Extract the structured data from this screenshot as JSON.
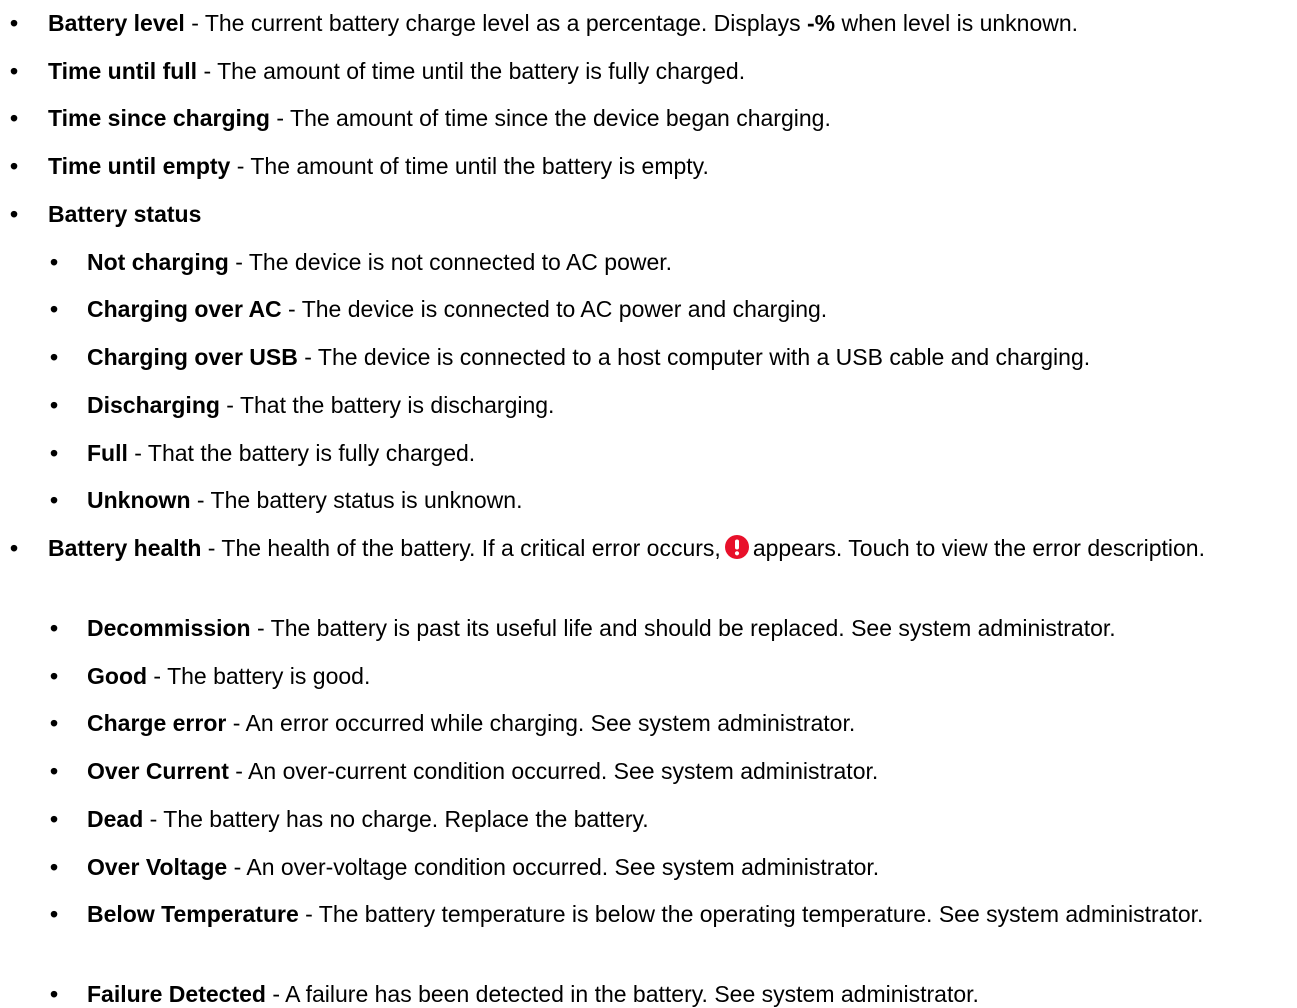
{
  "items": [
    {
      "term": "Battery level",
      "sep": " - ",
      "desc_a": "The current battery charge level as a percentage. Displays ",
      "desc_strong": "-%",
      "desc_b": " when level is unknown."
    },
    {
      "term": "Time until full",
      "sep": " - ",
      "desc": "The amount of time until the battery is fully charged."
    },
    {
      "term": "Time since charging",
      "sep": " - ",
      "desc": "The amount of time since the device began charging."
    },
    {
      "term": "Time until empty",
      "sep": " - ",
      "desc": "The amount of time until the battery is empty."
    },
    {
      "term": "Battery status"
    },
    {
      "term": "Not charging",
      "sep": " - ",
      "desc": "The device is not connected to AC power."
    },
    {
      "term": "Charging over AC",
      "sep": " - ",
      "desc": "The device is connected to AC power and charging."
    },
    {
      "term": "Charging over USB",
      "sep": " - ",
      "desc": "The device is connected to a host computer with a USB cable and charging."
    },
    {
      "term": "Discharging",
      "sep": " - ",
      "desc": "That the battery is discharging."
    },
    {
      "term": "Full",
      "sep": " - ",
      "desc": "That the battery is fully charged."
    },
    {
      "term": "Unknown",
      "sep": " - ",
      "desc": "The battery status is unknown."
    },
    {
      "term": "Battery health",
      "sep": " - ",
      "desc_a": "The health of the battery. If a critical error occurs,",
      "desc_b": "appears. Touch to view the error description.",
      "icon": "critical-error-icon",
      "icon_color": "#e8102a"
    },
    {
      "term": "Decommission",
      "sep": " - ",
      "desc": "The battery is past its useful life and should be replaced. See system administrator."
    },
    {
      "term": "Good",
      "sep": " - ",
      "desc": "The battery is good."
    },
    {
      "term": "Charge error",
      "sep": " - ",
      "desc": "An error occurred while charging. See system administrator."
    },
    {
      "term": "Over Current",
      "sep": " - ",
      "desc": "An over-current condition occurred. See system administrator."
    },
    {
      "term": "Dead",
      "sep": " - ",
      "desc": "The battery has no charge. Replace the battery."
    },
    {
      "term": "Over Voltage",
      "sep": " - ",
      "desc": "An over-voltage condition occurred. See system administrator."
    },
    {
      "term": "Below Temperature",
      "sep": " - ",
      "desc": "The battery temperature is below the operating temperature. See system administrator."
    },
    {
      "term": "Failure Detected",
      "sep": " - ",
      "desc": "A failure has been detected in the battery. See system administrator."
    }
  ],
  "bullet": "•"
}
